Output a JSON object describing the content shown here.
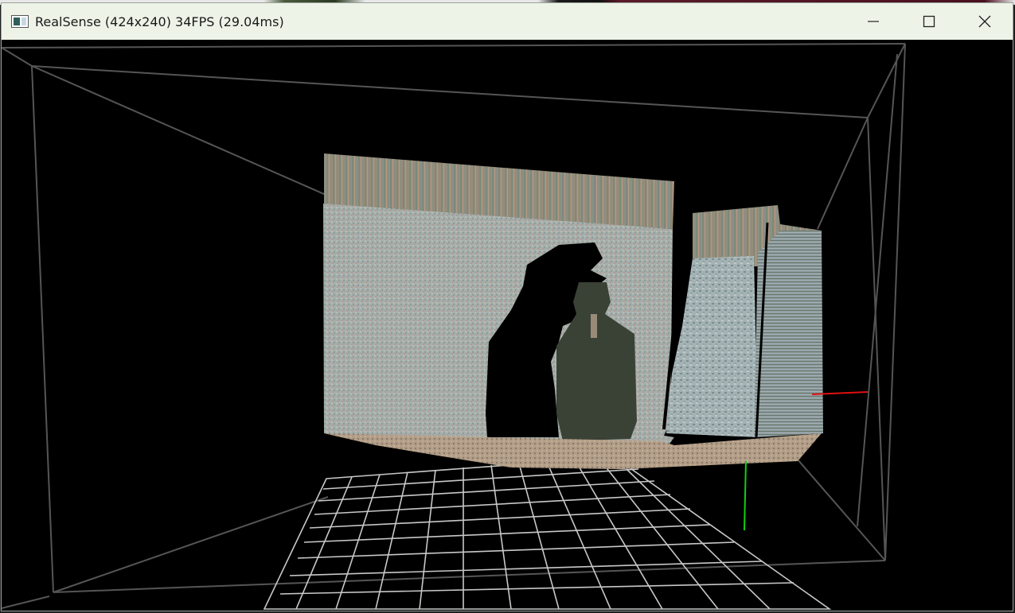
{
  "window": {
    "title": "RealSense (424x240) 34FPS (29.04ms)",
    "icon": "app-window-icon",
    "minimize_icon": "minimize-icon",
    "maximize_icon": "maximize-icon",
    "close_icon": "close-icon"
  },
  "viewport": {
    "content": "pointcloud-3d-view",
    "axes_colors": {
      "x": "#e01010",
      "y": "#10d010",
      "grid": "#c8c8c8",
      "frustum": "#555555"
    },
    "surface_colors": {
      "wall": "#a9b2ae",
      "wood": "#9c8f7a",
      "floor": "#b5a08a",
      "bottle": "#3a4236",
      "cushion": "#a8b6b8"
    }
  }
}
